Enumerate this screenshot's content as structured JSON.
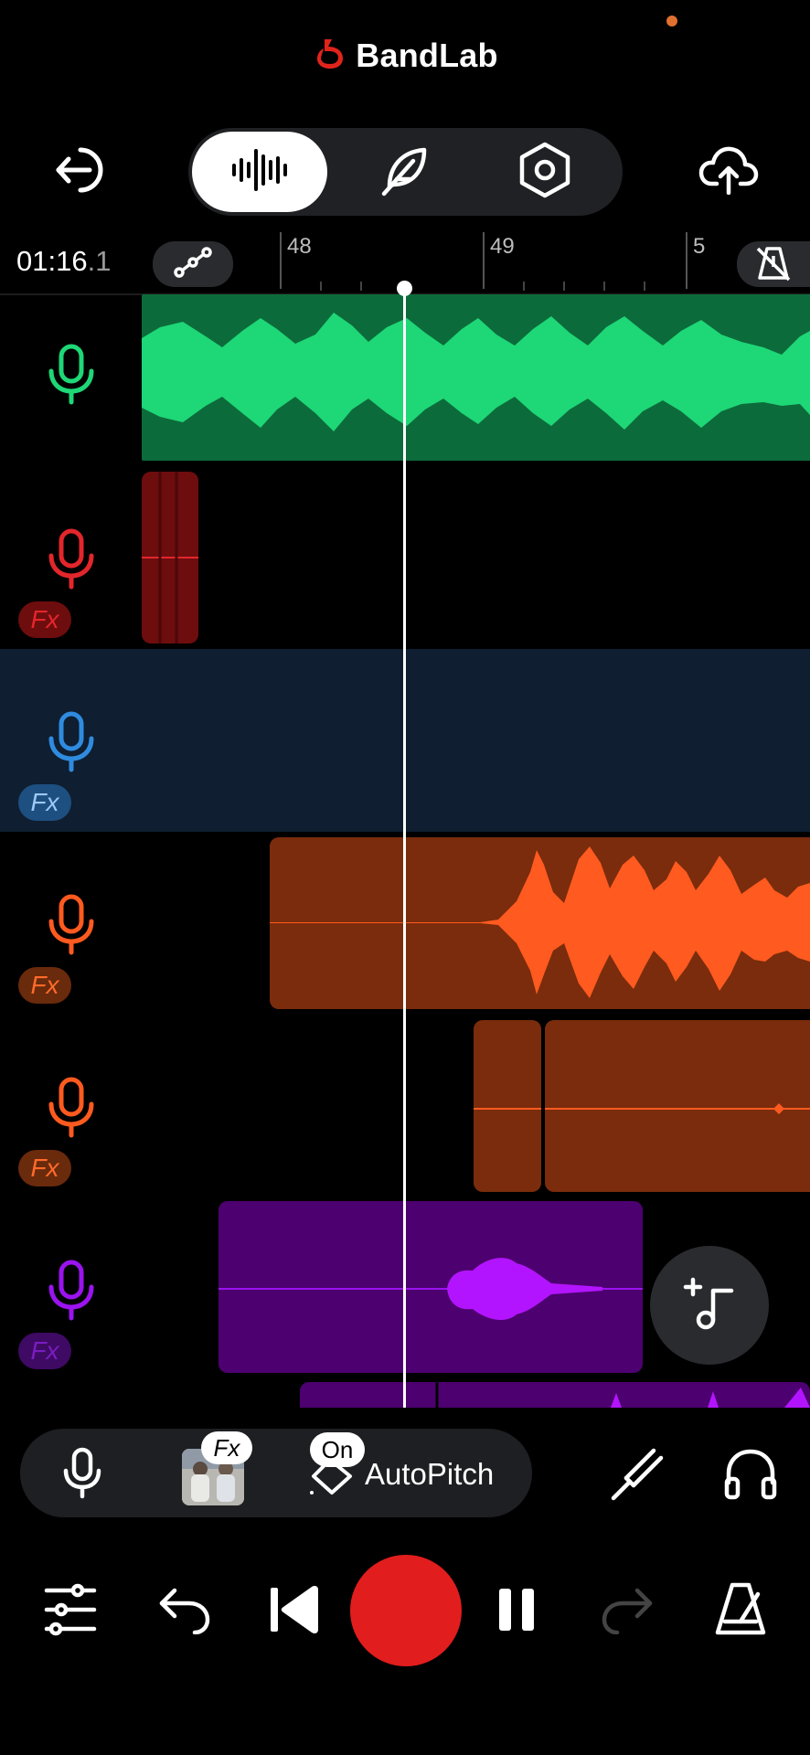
{
  "app": {
    "brand_name": "BandLab",
    "brand_color": "#e1241b"
  },
  "toolbar": {
    "back_icon": "exit-icon",
    "modes": [
      {
        "icon": "waveform-icon",
        "active": true
      },
      {
        "icon": "feather-icon",
        "active": false
      },
      {
        "icon": "hexagon-settings-icon",
        "active": false
      }
    ],
    "upload_icon": "cloud-upload-icon"
  },
  "timeline": {
    "time_main": "01:16",
    "time_fraction": ".1",
    "ruler_labels": [
      "48",
      "49",
      "5"
    ],
    "automation_icon": "automation-icon",
    "metronome_icon": "metronome-off-icon"
  },
  "tracks": [
    {
      "name": "track-1",
      "color": "#1ed776",
      "clip_color": "#0c6b3b",
      "fx": false
    },
    {
      "name": "track-2",
      "color": "#e3262b",
      "clip_color": "#6e0d0e",
      "fx": true
    },
    {
      "name": "track-3",
      "color": "#2f8bdf",
      "clip_color": "#0f1e30",
      "fx": true,
      "selected": true
    },
    {
      "name": "track-4",
      "color": "#ff5a1f",
      "clip_color": "#7a2c0c",
      "fx": true
    },
    {
      "name": "track-5",
      "color": "#ff5a1f",
      "clip_color": "#7a2c0c",
      "fx": true
    },
    {
      "name": "track-6",
      "color": "#9b13ef",
      "clip_color": "#4d006f",
      "fx": true
    }
  ],
  "fx_label": "Fx",
  "bottom_controls": {
    "mic_icon": "microphone-icon",
    "fx_badge": "Fx",
    "autopitch_on": "On",
    "autopitch_label": "AutoPitch",
    "tuner_icon": "tuning-fork-icon",
    "headphones_icon": "headphones-icon"
  },
  "transport": {
    "mixer_icon": "sliders-icon",
    "undo_icon": "undo-icon",
    "skip_back_icon": "skip-to-start-icon",
    "record_icon": "record-icon",
    "pause_icon": "pause-icon",
    "redo_icon": "redo-icon",
    "metronome_icon": "metronome-icon"
  },
  "add_track_icon": "add-music-note-icon"
}
